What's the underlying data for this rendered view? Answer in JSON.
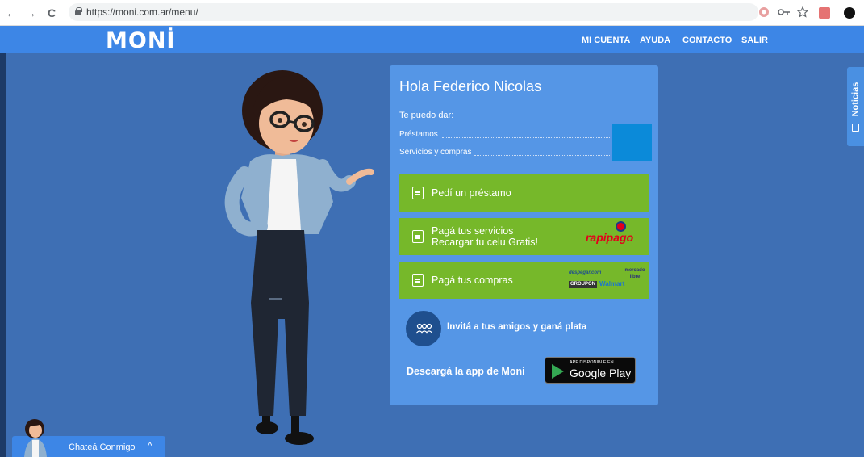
{
  "browser": {
    "back": "←",
    "forward": "→",
    "reload": "C",
    "url": "https://moni.com.ar/menu/"
  },
  "header": {
    "logo": "MONİ",
    "nav": [
      "MI CUENTA",
      "AYUDA",
      "CONTACTO",
      "SALIR"
    ]
  },
  "card": {
    "greeting": "Hola Federico Nicolas",
    "offer_intro": "Te puedo dar:",
    "offer_items": [
      "Préstamos",
      "Servicios y compras"
    ],
    "buttons": [
      {
        "label": "Pedí un préstamo",
        "icon": "wallet-icon"
      },
      {
        "label_line1": "Pagá tus servicios",
        "label_line2": "Recargar tu celu Gratis!",
        "icon": "receipt-icon",
        "brand": "rapipago"
      },
      {
        "label": "Pagá tus compras",
        "icon": "shopping-bag-icon",
        "brands": [
          "despegar.com",
          "mercado libre",
          "GROUPON",
          "Walmart"
        ]
      }
    ],
    "invite": "Invitá a tus amigos y ganá plata",
    "download": "Descargá la app de Moni",
    "gplay_small": "APP DISPONIBLE EN",
    "gplay_big": "Google Play"
  },
  "sidebar_tab": {
    "label": "Noticias"
  },
  "chat": {
    "label": "Chateá Conmigo",
    "chevron": "^"
  },
  "colors": {
    "page_bg": "#3e6fb4",
    "header_bg": "#3d86e6",
    "card_bg": "#5596e6",
    "green": "#76b82a",
    "rapipago_red": "#e3001b"
  }
}
